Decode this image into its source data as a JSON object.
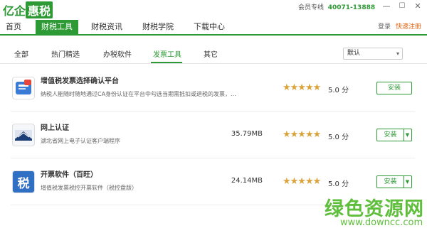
{
  "app": {
    "logo_text": "亿企",
    "logo_box": "惠税",
    "hotline_label": "会员专线",
    "hotline_number": "40071-13888",
    "window_controls": [
      "—",
      "☐",
      "✕"
    ]
  },
  "nav": {
    "items": [
      "首页",
      "财税工具",
      "财税资讯",
      "财税学院",
      "下载中心"
    ],
    "active_index": 1,
    "login": "登录",
    "register": "快速注册"
  },
  "subtabs": {
    "items": [
      "全部",
      "热门精选",
      "办税软件",
      "发票工具",
      "其它"
    ],
    "active_index": 3,
    "sort_value": "默认"
  },
  "apps": [
    {
      "name": "增值税发票选择确认平台",
      "desc": "纳税人能随时随地通过CA身份认证在平台中勾选当期需抵扣或退税的发票，...",
      "size": "",
      "rating_stars": 5,
      "score": "5.0 分",
      "install": "安装",
      "icon": "invoice-platform-icon",
      "split_button": false
    },
    {
      "name": "网上认证",
      "desc": "湖北省网上电子认证客户端程序",
      "size": "35.79MB",
      "rating_stars": 5,
      "score": "5.0 分",
      "install": "安装",
      "icon": "online-auth-icon",
      "split_button": true
    },
    {
      "name": "开票软件（百旺）",
      "desc": "增值税发票税控开票软件（税控盘版）",
      "size": "24.14MB",
      "rating_stars": 5,
      "score": "5.0 分",
      "install": "安装",
      "icon": "tax-char-icon",
      "split_button": true
    }
  ],
  "watermark": {
    "text": "绿色资源网",
    "url": "www.downcc.com"
  },
  "colors": {
    "brand_green": "#2e9a35",
    "star": "#d9a43a",
    "register_orange": "#e8600a"
  }
}
